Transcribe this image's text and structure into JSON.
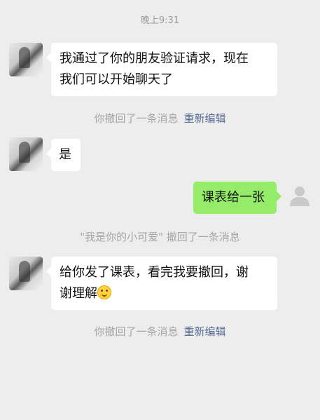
{
  "time_divider": "晚上9:31",
  "messages": [
    {
      "side": "left",
      "text_line1": "我通过了你的朋友验证请求，现在",
      "text_line2": "我们可以开始聊天了"
    },
    {
      "side": "left",
      "text": "是"
    },
    {
      "side": "right",
      "text": "课表给一张"
    },
    {
      "side": "left",
      "text_line1": "给你发了课表，看完我要撤回，谢",
      "text_line2": "谢理解"
    }
  ],
  "system_notices": [
    {
      "text": "你撤回了一条消息",
      "link": "重新编辑"
    },
    {
      "text": "\"我是你的小可爱\" 撤回了一条消息"
    },
    {
      "text": "你撤回了一条消息",
      "link": "重新编辑"
    }
  ],
  "emoji": "smiling-face-icon",
  "colors": {
    "background": "#ededed",
    "incoming_bubble": "#ffffff",
    "outgoing_bubble": "#95ec69",
    "link": "#576b95",
    "system_text": "#a6a6a6"
  }
}
